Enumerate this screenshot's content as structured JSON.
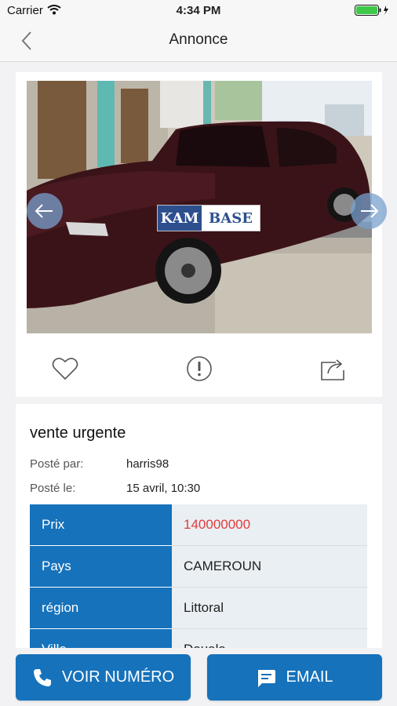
{
  "status_bar": {
    "carrier": "Carrier",
    "time": "4:34 PM",
    "battery_icon": "battery-charging-icon",
    "wifi_icon": "wifi-icon"
  },
  "nav": {
    "title": "Annonce",
    "back_icon": "chevron-left-icon"
  },
  "gallery": {
    "watermark_left": "KAM",
    "watermark_right": "BASE",
    "prev_icon": "arrow-left-icon",
    "next_icon": "arrow-right-icon"
  },
  "actions": {
    "like_icon": "heart-icon",
    "report_icon": "exclamation-circle-icon",
    "share_icon": "share-icon"
  },
  "listing": {
    "title": "vente urgente",
    "posted_by_label": "Posté par:",
    "posted_by": "harris98",
    "posted_on_label": "Posté le:",
    "posted_on": "15 avril, 10:30",
    "details": [
      {
        "key": "Prix",
        "value": "140000000"
      },
      {
        "key": "Pays",
        "value": "CAMEROUN"
      },
      {
        "key": "région",
        "value": "Littoral"
      },
      {
        "key": "Ville",
        "value": "Douala"
      }
    ]
  },
  "buttons": {
    "phone_label": "VOIR NUMÉRO",
    "email_label": "EMAIL"
  },
  "colors": {
    "accent": "#1672bb",
    "price": "#e23b3b",
    "background": "#f2f2f4"
  }
}
